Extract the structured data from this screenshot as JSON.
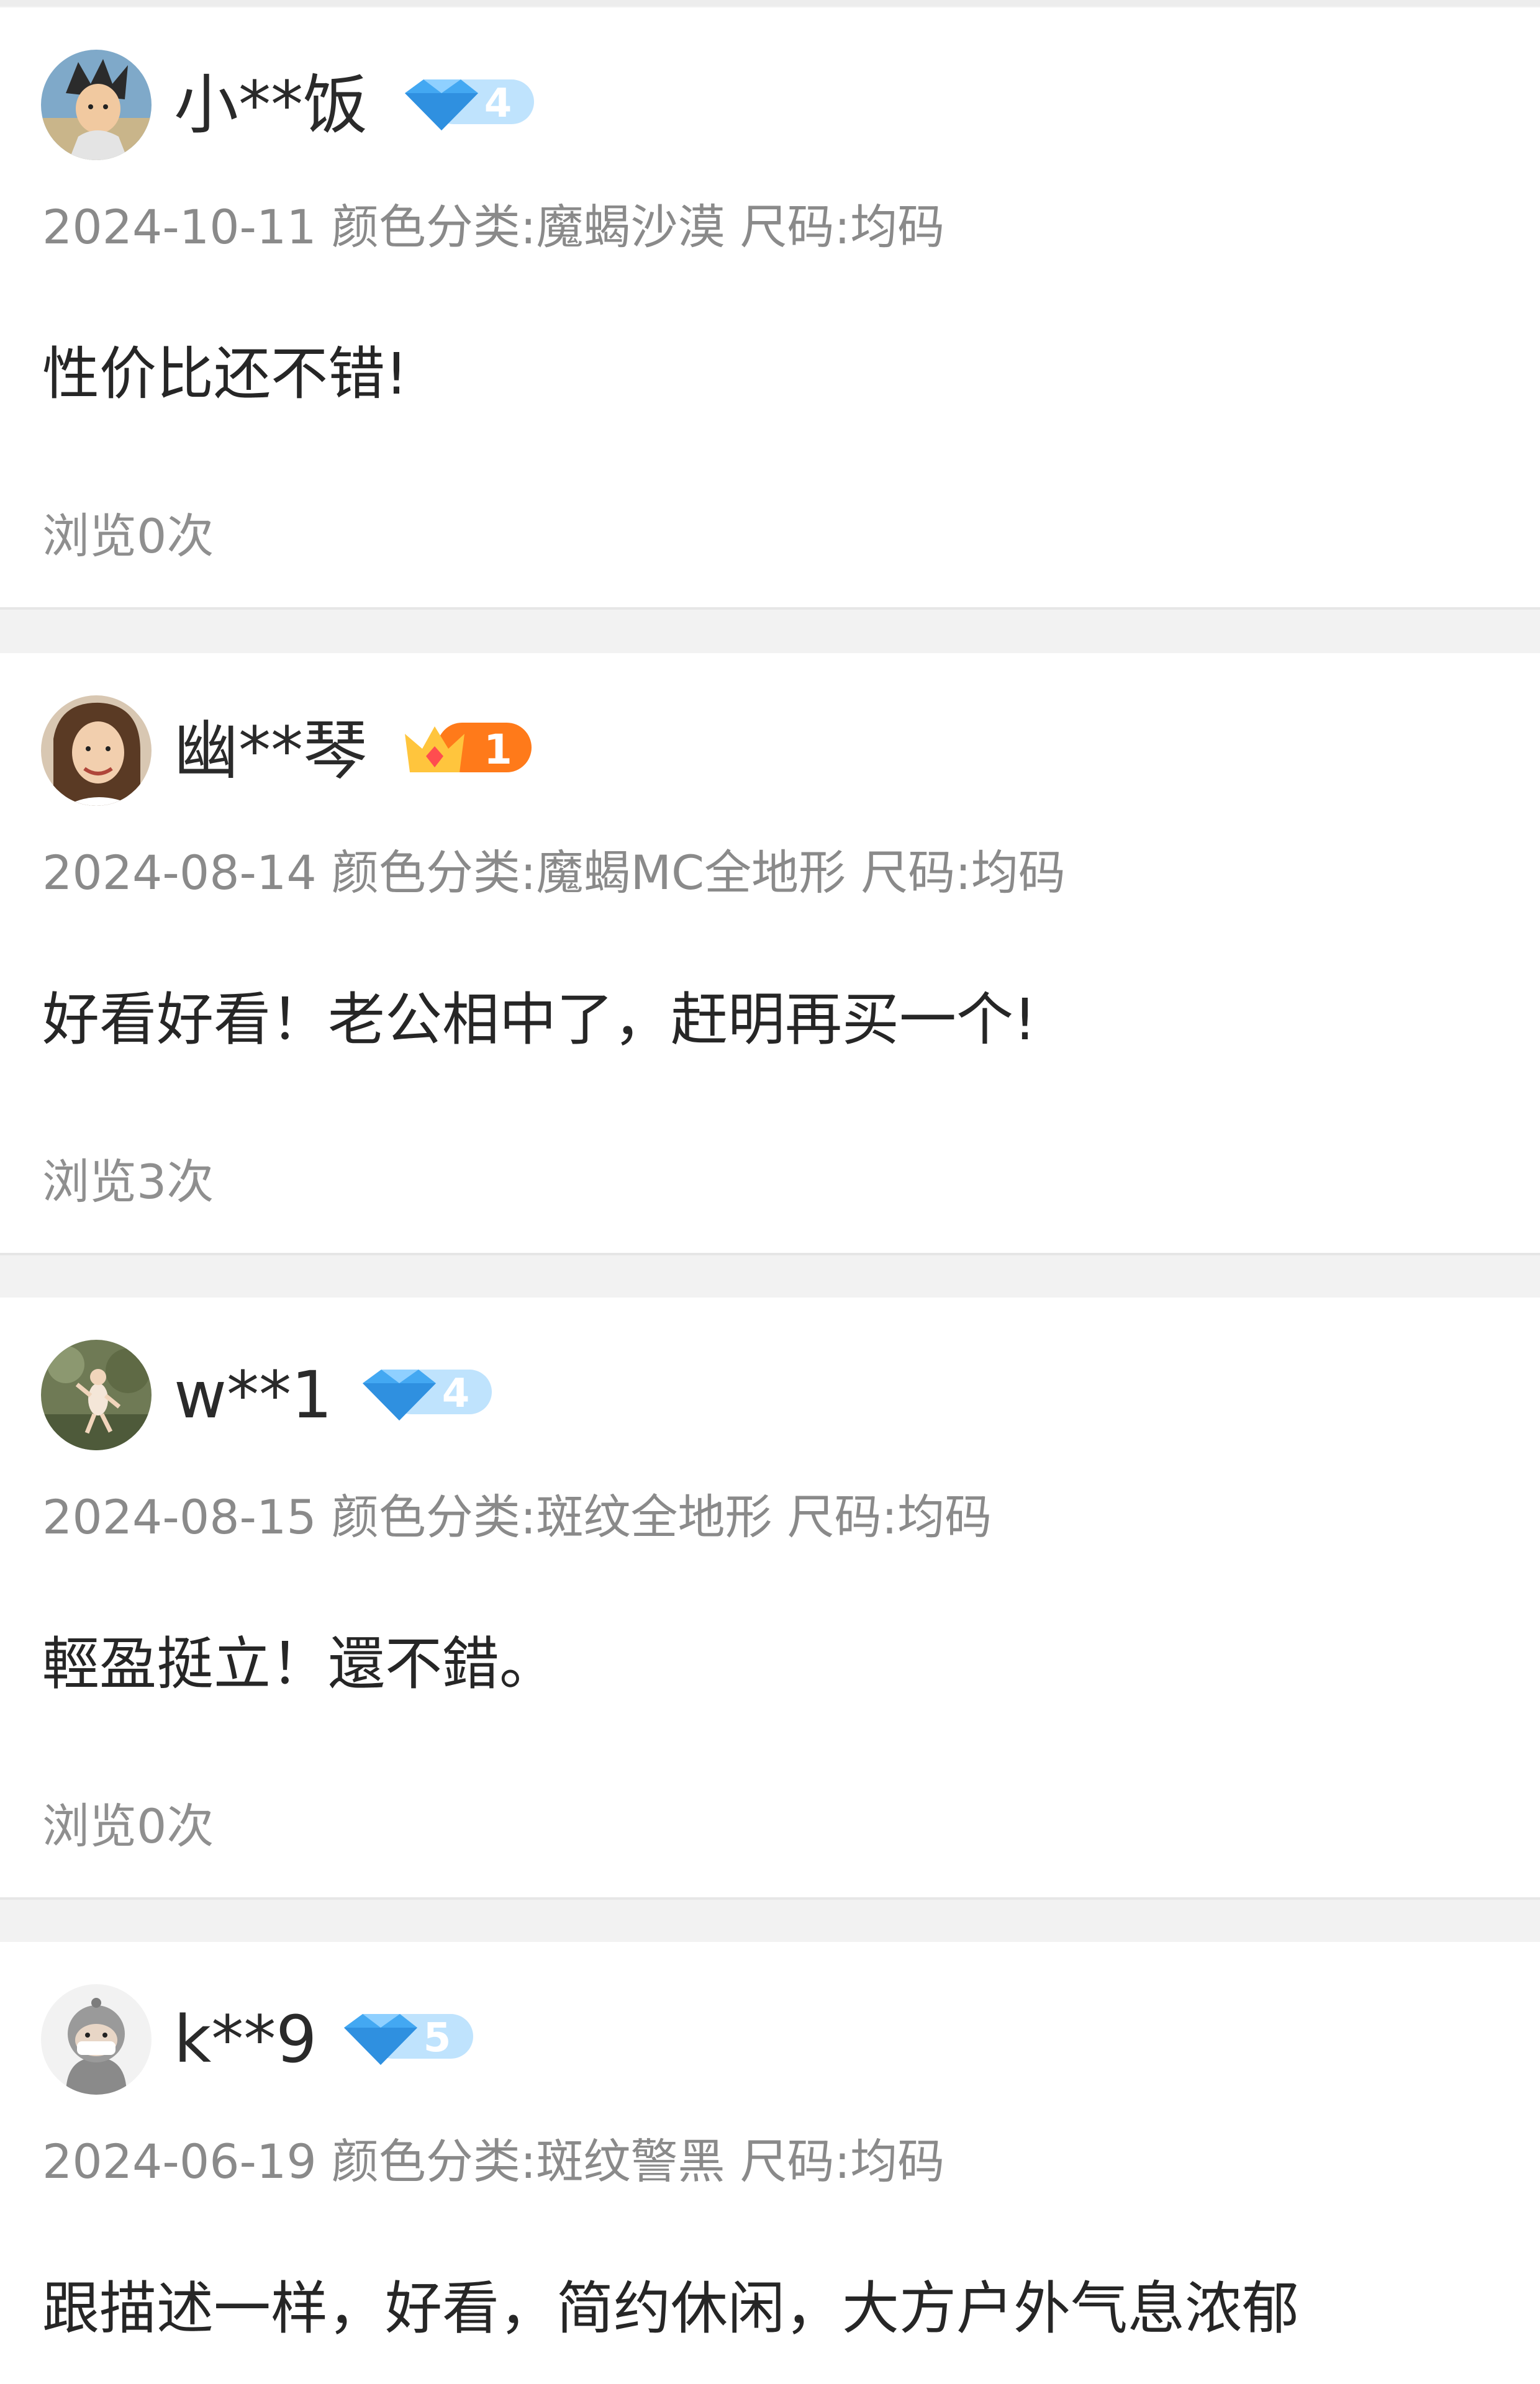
{
  "reviews": [
    {
      "username": "小**饭",
      "badge": {
        "type": "diamond",
        "level": "4"
      },
      "date": "2024-10-11",
      "variant": "颜色分类:魔蝎沙漠 尺码:均码",
      "comment": "性价比还不错!",
      "views": "浏览0次"
    },
    {
      "username": "幽**琴",
      "badge": {
        "type": "crown",
        "level": "1"
      },
      "date": "2024-08-14",
      "variant": "颜色分类:魔蝎MC全地形 尺码:均码",
      "comment": "好看好看！老公相中了，赶明再买一个!",
      "views": "浏览3次"
    },
    {
      "username": "w**1",
      "badge": {
        "type": "diamond",
        "level": "4"
      },
      "date": "2024-08-15",
      "variant": "颜色分类:斑纹全地形 尺码:均码",
      "comment": "輕盈挺立！還不錯。",
      "views": "浏览0次"
    },
    {
      "username": "k**9",
      "badge": {
        "type": "diamond",
        "level": "5"
      },
      "date": "2024-06-19",
      "variant": "颜色分类:斑纹警黑 尺码:均码",
      "comment": "跟描述一样，好看，简约休闲，大方户外气息浓郁"
    }
  ],
  "colors": {
    "diamond_blue": "#43a8f2",
    "diamond_light": "#a9d8fb",
    "crown_orange": "#ff7a1a",
    "crown_yellow": "#ffc53d",
    "meta_gray": "#8a8a8a"
  }
}
